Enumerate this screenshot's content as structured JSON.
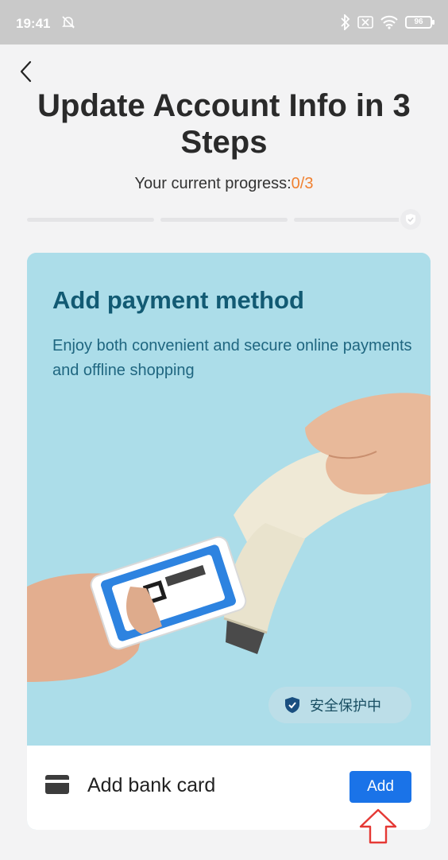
{
  "status_bar": {
    "time": "19:41",
    "battery": "96"
  },
  "header": {
    "title": "Update Account Info in 3 Steps",
    "progress_label": "Your current progress:",
    "progress_value": "0/3",
    "progress_fraction": 0
  },
  "card": {
    "title": "Add payment method",
    "description": "Enjoy both convenient and secure online payments and offline shopping",
    "security_badge": "安全保护中",
    "action_label": "Add bank card",
    "action_button": "Add"
  },
  "colors": {
    "accent": "#1a73e8",
    "progress_value": "#f08030",
    "card_title": "#125a73",
    "card_bg": "#acdde9",
    "hint_arrow": "#e53935"
  }
}
